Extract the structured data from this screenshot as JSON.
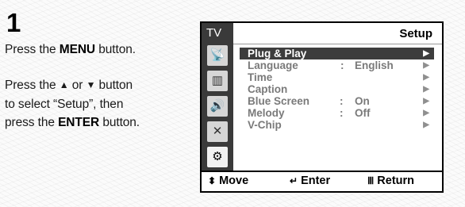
{
  "step": {
    "number": "1"
  },
  "instructions": {
    "line1": {
      "before": "Press the ",
      "bold": "MENU",
      "after": " button."
    },
    "line2": {
      "p1": "Press the ",
      "up_arrow": "▲",
      "or": " or ",
      "down_arrow": "▼",
      "p2": " button",
      "p3": "to select “Setup”, then",
      "p4": "press the ",
      "bold": "ENTER",
      "p5": " button."
    }
  },
  "osd": {
    "tv_label": "TV",
    "title": "Setup",
    "side_icons": [
      {
        "name": "antenna-icon",
        "glyph": "📡"
      },
      {
        "name": "picture-icon",
        "glyph": "▥"
      },
      {
        "name": "sound-icon",
        "glyph": "🔊"
      },
      {
        "name": "channel-icon",
        "glyph": "✕"
      },
      {
        "name": "setup-icon",
        "glyph": "⚙"
      }
    ],
    "menu": [
      {
        "label": "Plug & Play",
        "sep": "",
        "value": "",
        "selected": true
      },
      {
        "label": "Language",
        "sep": ":",
        "value": "English",
        "selected": false
      },
      {
        "label": "Time",
        "sep": "",
        "value": "",
        "selected": false
      },
      {
        "label": "Caption",
        "sep": "",
        "value": "",
        "selected": false
      },
      {
        "label": "Blue Screen",
        "sep": ":",
        "value": "On",
        "selected": false
      },
      {
        "label": "Melody",
        "sep": ":",
        "value": "Off",
        "selected": false
      },
      {
        "label": "V-Chip",
        "sep": "",
        "value": "",
        "selected": false
      }
    ],
    "arrow_glyph": "▶",
    "footer": {
      "move": {
        "icon": "⬍",
        "label": "Move"
      },
      "enter": {
        "icon": "↵",
        "label": "Enter"
      },
      "return": {
        "icon": "Ⅲ",
        "label": "Return"
      }
    }
  }
}
